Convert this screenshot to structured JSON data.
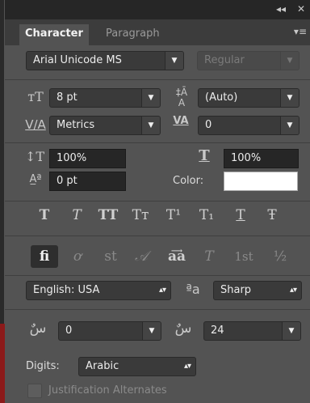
{
  "titlebar": {
    "collapse_icon": "double-left-arrow-icon",
    "close_icon": "close-icon"
  },
  "tabs": [
    {
      "label": "Character",
      "active": true
    },
    {
      "label": "Paragraph",
      "active": false
    }
  ],
  "panel_menu_icon": "panel-menu-icon",
  "font": {
    "family": "Arial Unicode MS",
    "style": "Regular"
  },
  "size": {
    "value": "8 pt"
  },
  "leading": {
    "value": "(Auto)"
  },
  "kerning": {
    "value": "Metrics"
  },
  "tracking": {
    "value": "0"
  },
  "vertical_scale": {
    "value": "100%"
  },
  "horizontal_scale": {
    "value": "100%"
  },
  "baseline_shift": {
    "value": "0 pt"
  },
  "color": {
    "label": "Color:",
    "swatch": "#ffffff"
  },
  "style_buttons": [
    {
      "name": "faux-bold",
      "glyph": "T"
    },
    {
      "name": "faux-italic",
      "glyph": "T"
    },
    {
      "name": "all-caps",
      "glyph": "TT"
    },
    {
      "name": "small-caps",
      "glyph": "Tт"
    },
    {
      "name": "superscript",
      "glyph": "T¹"
    },
    {
      "name": "subscript",
      "glyph": "T₁"
    },
    {
      "name": "underline",
      "glyph": "T"
    },
    {
      "name": "strikethrough",
      "glyph": "Ŧ"
    }
  ],
  "opentype_buttons": [
    {
      "name": "ligatures",
      "glyph": "fi"
    },
    {
      "name": "old-style",
      "glyph": "ơ"
    },
    {
      "name": "discretionary-ligatures",
      "glyph": "st"
    },
    {
      "name": "swash",
      "glyph": "𝒜"
    },
    {
      "name": "stylistic-alternates",
      "glyph": "aa"
    },
    {
      "name": "titling-alternates",
      "glyph": "T"
    },
    {
      "name": "ordinals",
      "glyph": "1st"
    },
    {
      "name": "fractions",
      "glyph": "½"
    }
  ],
  "language": {
    "value": "English: USA"
  },
  "antialias": {
    "icon_text": "ªa",
    "value": "Sharp"
  },
  "arabic_left": {
    "value": "0"
  },
  "arabic_right": {
    "value": "24"
  },
  "digits": {
    "label": "Digits:",
    "value": "Arabic"
  },
  "justification": {
    "label": "Justification Alternates",
    "checked": false
  }
}
